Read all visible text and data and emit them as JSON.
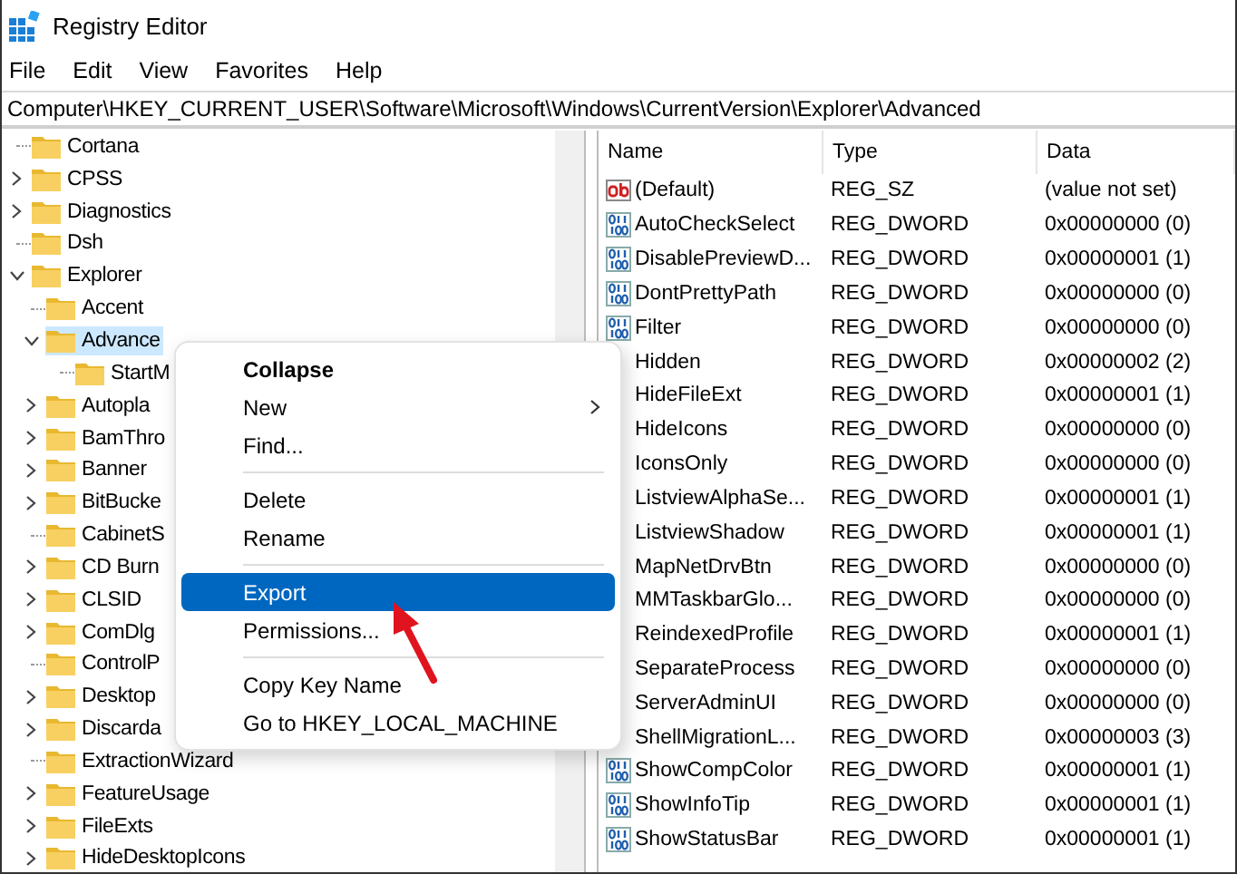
{
  "window": {
    "title": "Registry Editor"
  },
  "menu_bar": [
    "File",
    "Edit",
    "View",
    "Favorites",
    "Help"
  ],
  "address": "Computer\\HKEY_CURRENT_USER\\Software\\Microsoft\\Windows\\CurrentVersion\\Explorer\\Advanced",
  "tree": [
    {
      "label": "Cortana",
      "kind": "leaf",
      "selected": false
    },
    {
      "label": "CPSS",
      "kind": "collapsed",
      "selected": false
    },
    {
      "label": "Diagnostics",
      "kind": "collapsed",
      "selected": false
    },
    {
      "label": "Dsh",
      "kind": "leaf",
      "selected": false
    },
    {
      "label": "Explorer",
      "kind": "expanded",
      "selected": false,
      "children": [
        {
          "label": "Accent",
          "kind": "leaf",
          "selected": false
        },
        {
          "label": "Advance",
          "kind": "expanded",
          "selected": true,
          "children": [
            {
              "label": "StartM",
              "kind": "leaf",
              "selected": false
            }
          ]
        },
        {
          "label": "Autopla",
          "kind": "collapsed",
          "selected": false
        },
        {
          "label": "BamThro",
          "kind": "collapsed",
          "selected": false
        },
        {
          "label": "Banner",
          "kind": "collapsed",
          "selected": false
        },
        {
          "label": "BitBucke",
          "kind": "collapsed",
          "selected": false
        },
        {
          "label": "CabinetS",
          "kind": "leaf",
          "selected": false
        },
        {
          "label": "CD Burn",
          "kind": "collapsed",
          "selected": false
        },
        {
          "label": "CLSID",
          "kind": "collapsed",
          "selected": false
        },
        {
          "label": "ComDlg",
          "kind": "collapsed",
          "selected": false
        },
        {
          "label": "ControlP",
          "kind": "leaf",
          "selected": false
        },
        {
          "label": "Desktop",
          "kind": "collapsed",
          "selected": false
        },
        {
          "label": "Discarda",
          "kind": "collapsed",
          "selected": false
        },
        {
          "label": "ExtractionWizard",
          "kind": "leaf",
          "selected": false
        },
        {
          "label": "FeatureUsage",
          "kind": "collapsed",
          "selected": false
        },
        {
          "label": "FileExts",
          "kind": "collapsed",
          "selected": false
        },
        {
          "label": "HideDesktopIcons",
          "kind": "collapsed",
          "selected": false
        }
      ]
    }
  ],
  "values": {
    "columns": [
      "Name",
      "Type",
      "Data"
    ],
    "rows": [
      {
        "kind": "string",
        "name": "(Default)",
        "type": "REG_SZ",
        "data": "(value not set)"
      },
      {
        "kind": "dword",
        "name": "AutoCheckSelect",
        "type": "REG_DWORD",
        "data": "0x00000000 (0)"
      },
      {
        "kind": "dword",
        "name": "DisablePreviewD...",
        "type": "REG_DWORD",
        "data": "0x00000001 (1)"
      },
      {
        "kind": "dword",
        "name": "DontPrettyPath",
        "type": "REG_DWORD",
        "data": "0x00000000 (0)"
      },
      {
        "kind": "dword",
        "name": "Filter",
        "type": "REG_DWORD",
        "data": "0x00000000 (0)"
      },
      {
        "name": "Hidden",
        "type": "REG_DWORD",
        "data": "0x00000002 (2)"
      },
      {
        "name": "HideFileExt",
        "type": "REG_DWORD",
        "data": "0x00000001 (1)"
      },
      {
        "name": "HideIcons",
        "type": "REG_DWORD",
        "data": "0x00000000 (0)"
      },
      {
        "name": "IconsOnly",
        "type": "REG_DWORD",
        "data": "0x00000000 (0)"
      },
      {
        "name": "ListviewAlphaSe...",
        "type": "REG_DWORD",
        "data": "0x00000001 (1)"
      },
      {
        "name": "ListviewShadow",
        "type": "REG_DWORD",
        "data": "0x00000001 (1)"
      },
      {
        "name": "MapNetDrvBtn",
        "type": "REG_DWORD",
        "data": "0x00000000 (0)"
      },
      {
        "name": "MMTaskbarGlo...",
        "type": "REG_DWORD",
        "data": "0x00000000 (0)"
      },
      {
        "name": "ReindexedProfile",
        "type": "REG_DWORD",
        "data": "0x00000001 (1)"
      },
      {
        "name": "SeparateProcess",
        "type": "REG_DWORD",
        "data": "0x00000000 (0)"
      },
      {
        "name": "ServerAdminUI",
        "type": "REG_DWORD",
        "data": "0x00000000 (0)"
      },
      {
        "name": "ShellMigrationL...",
        "type": "REG_DWORD",
        "data": "0x00000003 (3)"
      },
      {
        "kind": "dword",
        "name": "ShowCompColor",
        "type": "REG_DWORD",
        "data": "0x00000001 (1)"
      },
      {
        "kind": "dword",
        "name": "ShowInfoTip",
        "type": "REG_DWORD",
        "data": "0x00000001 (1)"
      },
      {
        "kind": "dword",
        "name": "ShowStatusBar",
        "type": "REG_DWORD",
        "data": "0x00000001 (1)"
      }
    ]
  },
  "context_menu": [
    {
      "kind": "item",
      "label": "Collapse",
      "default": true,
      "submenu": false,
      "selected": false
    },
    {
      "kind": "item",
      "label": "New",
      "default": false,
      "submenu": true,
      "selected": false
    },
    {
      "kind": "item",
      "label": "Find...",
      "default": false,
      "submenu": false,
      "selected": false
    },
    {
      "kind": "separator"
    },
    {
      "kind": "item",
      "label": "Delete",
      "default": false,
      "submenu": false,
      "selected": false
    },
    {
      "kind": "item",
      "label": "Rename",
      "default": false,
      "submenu": false,
      "selected": false
    },
    {
      "kind": "separator"
    },
    {
      "kind": "item",
      "label": "Export",
      "default": false,
      "submenu": false,
      "selected": true
    },
    {
      "kind": "item",
      "label": "Permissions...",
      "default": false,
      "submenu": false,
      "selected": false
    },
    {
      "kind": "separator"
    },
    {
      "kind": "item",
      "label": "Copy Key Name",
      "default": false,
      "submenu": false,
      "selected": false
    },
    {
      "kind": "item",
      "label": "Go to HKEY_LOCAL_MACHINE",
      "default": false,
      "submenu": false,
      "selected": false
    }
  ],
  "annotation": {
    "kind": "arrow"
  }
}
